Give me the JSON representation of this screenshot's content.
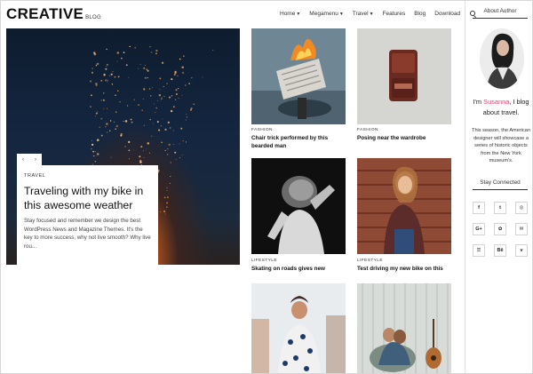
{
  "header": {
    "logo_main": "CREATIVE",
    "logo_sub": "BLOG",
    "nav": [
      {
        "label": "Home",
        "dropdown": true
      },
      {
        "label": "Megamenu",
        "dropdown": true
      },
      {
        "label": "Travel",
        "dropdown": true
      },
      {
        "label": "Features",
        "dropdown": false
      },
      {
        "label": "Blog",
        "dropdown": false
      },
      {
        "label": "Download",
        "dropdown": false
      }
    ],
    "search_icon": "search-icon"
  },
  "hero": {
    "category": "TRAVEL",
    "title": "Traveling with my bike in this awesome weather",
    "excerpt": "Stay focused and remember we design the best WordPress News and Magazine Themes. It's the key to more success, why not live smooth? Why live rou...",
    "prev_arrow": "‹",
    "next_arrow": "›"
  },
  "posts": [
    {
      "category": "FASHION",
      "title": "Chair trick performed by this bearded man"
    },
    {
      "category": "FASHION",
      "title": "Posing near the wardrobe"
    },
    {
      "category": "LIFESTYLE",
      "title": "Skating on roads gives new"
    },
    {
      "category": "LIFESTYLE",
      "title": "Test driving my new bike on this"
    },
    {
      "category": "",
      "title": ""
    },
    {
      "category": "",
      "title": ""
    }
  ],
  "sidebar": {
    "about_heading": "About Author",
    "intro_prefix": "I'm ",
    "intro_name": "Susanna",
    "intro_suffix": ", I blog about travel.",
    "bio": "This season, the American designer will showcase a series of historic objects from the New York museum's.",
    "connect_heading": "Stay Connected",
    "social": [
      "f",
      "t",
      "◎",
      "G+",
      "✿",
      "✉",
      "☰",
      "Bē",
      "v"
    ],
    "accent_color": "#e0447a"
  }
}
